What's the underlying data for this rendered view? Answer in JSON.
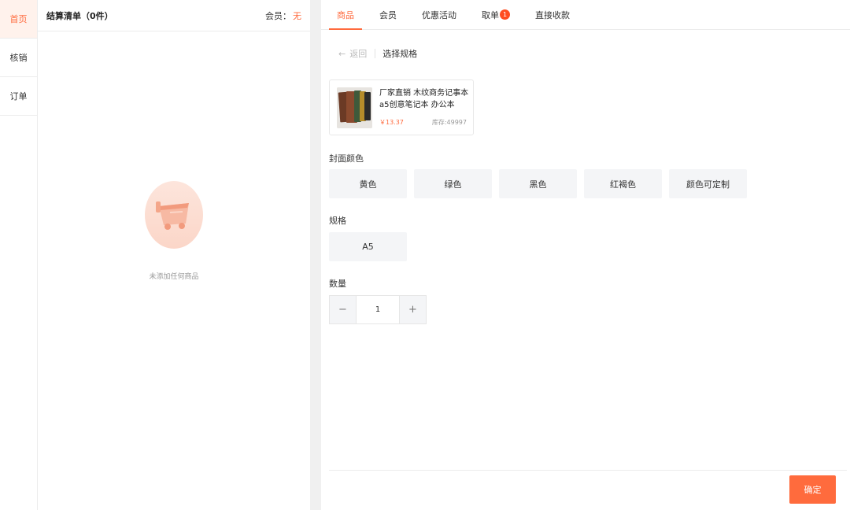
{
  "nav": {
    "items": [
      {
        "label": "首页",
        "active": true
      },
      {
        "label": "核销",
        "active": false
      },
      {
        "label": "订单",
        "active": false
      }
    ]
  },
  "cart": {
    "title": "结算清单（0件）",
    "member_label": "会员：",
    "member_value": "无",
    "empty_text": "未添加任何商品"
  },
  "tabs": [
    {
      "label": "商品",
      "active": true
    },
    {
      "label": "会员"
    },
    {
      "label": "优惠活动"
    },
    {
      "label": "取单",
      "badge": "1"
    },
    {
      "label": "直接收款"
    }
  ],
  "spec": {
    "back_label": "返回",
    "breadcrumb": "选择规格",
    "product": {
      "name": "厂家直销 木纹商务记事本 a5创意笔记本 办公本子...",
      "price": "￥13.37",
      "stock": "库存:49997"
    },
    "cover_color": {
      "label": "封面颜色",
      "options": [
        "黄色",
        "绿色",
        "黑色",
        "红褐色",
        "颜色可定制"
      ]
    },
    "size": {
      "label": "规格",
      "options": [
        "A5"
      ]
    },
    "quantity": {
      "label": "数量",
      "value": "1",
      "minus": "−",
      "plus": "+"
    },
    "confirm_label": "确定"
  },
  "colors": {
    "accent": "#ff6a3d",
    "badge": "#ff4d20",
    "option_bg": "#f4f5f7"
  }
}
